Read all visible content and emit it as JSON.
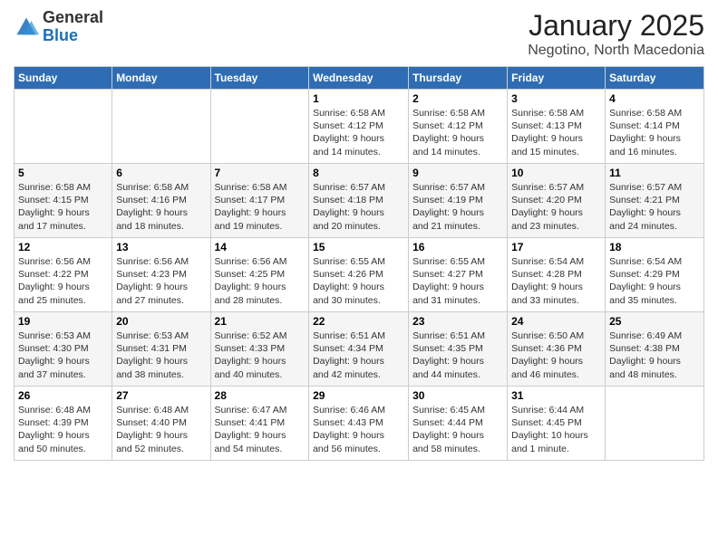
{
  "logo": {
    "general": "General",
    "blue": "Blue"
  },
  "title": "January 2025",
  "subtitle": "Negotino, North Macedonia",
  "days_header": [
    "Sunday",
    "Monday",
    "Tuesday",
    "Wednesday",
    "Thursday",
    "Friday",
    "Saturday"
  ],
  "weeks": [
    [
      {
        "day": "",
        "info": ""
      },
      {
        "day": "",
        "info": ""
      },
      {
        "day": "",
        "info": ""
      },
      {
        "day": "1",
        "info": "Sunrise: 6:58 AM\nSunset: 4:12 PM\nDaylight: 9 hours\nand 14 minutes."
      },
      {
        "day": "2",
        "info": "Sunrise: 6:58 AM\nSunset: 4:12 PM\nDaylight: 9 hours\nand 14 minutes."
      },
      {
        "day": "3",
        "info": "Sunrise: 6:58 AM\nSunset: 4:13 PM\nDaylight: 9 hours\nand 15 minutes."
      },
      {
        "day": "4",
        "info": "Sunrise: 6:58 AM\nSunset: 4:14 PM\nDaylight: 9 hours\nand 16 minutes."
      }
    ],
    [
      {
        "day": "5",
        "info": "Sunrise: 6:58 AM\nSunset: 4:15 PM\nDaylight: 9 hours\nand 17 minutes."
      },
      {
        "day": "6",
        "info": "Sunrise: 6:58 AM\nSunset: 4:16 PM\nDaylight: 9 hours\nand 18 minutes."
      },
      {
        "day": "7",
        "info": "Sunrise: 6:58 AM\nSunset: 4:17 PM\nDaylight: 9 hours\nand 19 minutes."
      },
      {
        "day": "8",
        "info": "Sunrise: 6:57 AM\nSunset: 4:18 PM\nDaylight: 9 hours\nand 20 minutes."
      },
      {
        "day": "9",
        "info": "Sunrise: 6:57 AM\nSunset: 4:19 PM\nDaylight: 9 hours\nand 21 minutes."
      },
      {
        "day": "10",
        "info": "Sunrise: 6:57 AM\nSunset: 4:20 PM\nDaylight: 9 hours\nand 23 minutes."
      },
      {
        "day": "11",
        "info": "Sunrise: 6:57 AM\nSunset: 4:21 PM\nDaylight: 9 hours\nand 24 minutes."
      }
    ],
    [
      {
        "day": "12",
        "info": "Sunrise: 6:56 AM\nSunset: 4:22 PM\nDaylight: 9 hours\nand 25 minutes."
      },
      {
        "day": "13",
        "info": "Sunrise: 6:56 AM\nSunset: 4:23 PM\nDaylight: 9 hours\nand 27 minutes."
      },
      {
        "day": "14",
        "info": "Sunrise: 6:56 AM\nSunset: 4:25 PM\nDaylight: 9 hours\nand 28 minutes."
      },
      {
        "day": "15",
        "info": "Sunrise: 6:55 AM\nSunset: 4:26 PM\nDaylight: 9 hours\nand 30 minutes."
      },
      {
        "day": "16",
        "info": "Sunrise: 6:55 AM\nSunset: 4:27 PM\nDaylight: 9 hours\nand 31 minutes."
      },
      {
        "day": "17",
        "info": "Sunrise: 6:54 AM\nSunset: 4:28 PM\nDaylight: 9 hours\nand 33 minutes."
      },
      {
        "day": "18",
        "info": "Sunrise: 6:54 AM\nSunset: 4:29 PM\nDaylight: 9 hours\nand 35 minutes."
      }
    ],
    [
      {
        "day": "19",
        "info": "Sunrise: 6:53 AM\nSunset: 4:30 PM\nDaylight: 9 hours\nand 37 minutes."
      },
      {
        "day": "20",
        "info": "Sunrise: 6:53 AM\nSunset: 4:31 PM\nDaylight: 9 hours\nand 38 minutes."
      },
      {
        "day": "21",
        "info": "Sunrise: 6:52 AM\nSunset: 4:33 PM\nDaylight: 9 hours\nand 40 minutes."
      },
      {
        "day": "22",
        "info": "Sunrise: 6:51 AM\nSunset: 4:34 PM\nDaylight: 9 hours\nand 42 minutes."
      },
      {
        "day": "23",
        "info": "Sunrise: 6:51 AM\nSunset: 4:35 PM\nDaylight: 9 hours\nand 44 minutes."
      },
      {
        "day": "24",
        "info": "Sunrise: 6:50 AM\nSunset: 4:36 PM\nDaylight: 9 hours\nand 46 minutes."
      },
      {
        "day": "25",
        "info": "Sunrise: 6:49 AM\nSunset: 4:38 PM\nDaylight: 9 hours\nand 48 minutes."
      }
    ],
    [
      {
        "day": "26",
        "info": "Sunrise: 6:48 AM\nSunset: 4:39 PM\nDaylight: 9 hours\nand 50 minutes."
      },
      {
        "day": "27",
        "info": "Sunrise: 6:48 AM\nSunset: 4:40 PM\nDaylight: 9 hours\nand 52 minutes."
      },
      {
        "day": "28",
        "info": "Sunrise: 6:47 AM\nSunset: 4:41 PM\nDaylight: 9 hours\nand 54 minutes."
      },
      {
        "day": "29",
        "info": "Sunrise: 6:46 AM\nSunset: 4:43 PM\nDaylight: 9 hours\nand 56 minutes."
      },
      {
        "day": "30",
        "info": "Sunrise: 6:45 AM\nSunset: 4:44 PM\nDaylight: 9 hours\nand 58 minutes."
      },
      {
        "day": "31",
        "info": "Sunrise: 6:44 AM\nSunset: 4:45 PM\nDaylight: 10 hours\nand 1 minute."
      },
      {
        "day": "",
        "info": ""
      }
    ]
  ]
}
